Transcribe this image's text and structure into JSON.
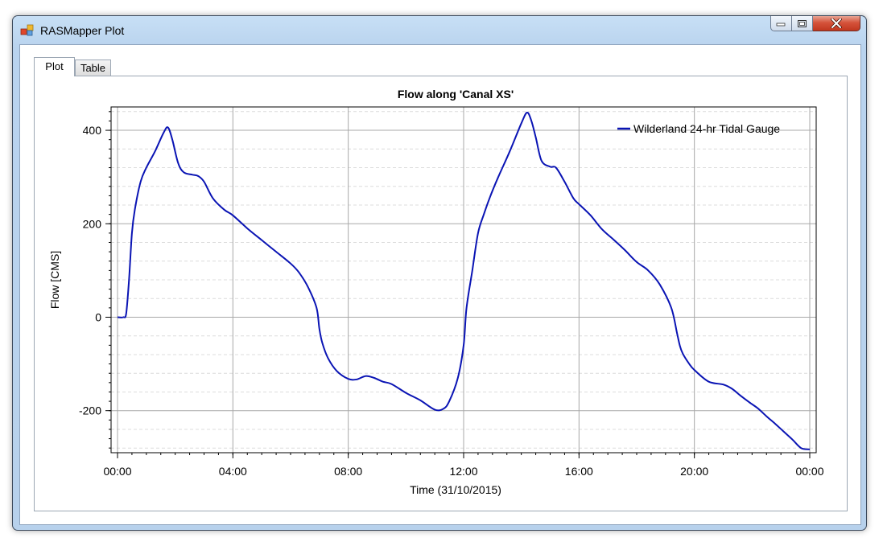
{
  "window": {
    "title": "RASMapper Plot",
    "accent_color": "#b9d3ee"
  },
  "tabs": [
    {
      "label": "Plot",
      "selected": true
    },
    {
      "label": "Table",
      "selected": false
    }
  ],
  "chart_data": {
    "type": "line",
    "title": "Flow along 'Canal XS'",
    "xlabel": "Time (31/10/2015)",
    "ylabel": "Flow [CMS]",
    "x_unit": "hours",
    "xlim": [
      0,
      24
    ],
    "ylim": [
      -290,
      450
    ],
    "x_ticks": [
      {
        "value": 0,
        "label": "00:00"
      },
      {
        "value": 4,
        "label": "04:00"
      },
      {
        "value": 8,
        "label": "08:00"
      },
      {
        "value": 12,
        "label": "12:00"
      },
      {
        "value": 16,
        "label": "16:00"
      },
      {
        "value": 20,
        "label": "20:00"
      },
      {
        "value": 24,
        "label": "00:00"
      }
    ],
    "y_ticks": [
      {
        "value": 400,
        "label": "400"
      },
      {
        "value": 200,
        "label": "200"
      },
      {
        "value": 0,
        "label": "0"
      },
      {
        "value": -200,
        "label": "-200"
      }
    ],
    "grid": true,
    "legend_position": "top-right",
    "series": [
      {
        "name": "Wilderland 24-hr Tidal Gauge",
        "color": "#0a14b4",
        "x": [
          0,
          0.2,
          0.3,
          0.4,
          0.5,
          0.6,
          0.8,
          1.0,
          1.3,
          1.6,
          1.75,
          1.9,
          2.1,
          2.3,
          2.6,
          2.8,
          3.0,
          3.3,
          3.7,
          4.0,
          4.5,
          5.0,
          5.5,
          6.0,
          6.3,
          6.6,
          6.9,
          7.0,
          7.1,
          7.3,
          7.6,
          8.0,
          8.3,
          8.6,
          8.9,
          9.2,
          9.5,
          10.0,
          10.5,
          11.0,
          11.3,
          11.5,
          11.8,
          12.0,
          12.1,
          12.3,
          12.5,
          12.7,
          12.9,
          13.2,
          13.6,
          14.0,
          14.2,
          14.35,
          14.5,
          14.7,
          15.0,
          15.2,
          15.5,
          15.8,
          16.0,
          16.4,
          16.8,
          17.2,
          17.6,
          18.0,
          18.4,
          18.8,
          19.2,
          19.4,
          19.5,
          19.6,
          19.8,
          20.0,
          20.5,
          21.0,
          21.3,
          21.6,
          21.9,
          22.2,
          22.5,
          22.8,
          23.1,
          23.4,
          23.7,
          24.0
        ],
        "y": [
          0,
          0,
          8,
          80,
          180,
          230,
          290,
          320,
          355,
          395,
          406,
          380,
          330,
          310,
          305,
          302,
          290,
          255,
          230,
          218,
          190,
          165,
          140,
          115,
          95,
          65,
          20,
          -25,
          -55,
          -88,
          -115,
          -132,
          -133,
          -126,
          -130,
          -138,
          -143,
          -162,
          -178,
          -198,
          -196,
          -180,
          -130,
          -60,
          20,
          100,
          180,
          220,
          255,
          300,
          355,
          415,
          438,
          420,
          385,
          335,
          322,
          320,
          290,
          255,
          242,
          218,
          188,
          166,
          143,
          118,
          100,
          70,
          20,
          -35,
          -62,
          -78,
          -98,
          -113,
          -138,
          -144,
          -153,
          -168,
          -182,
          -195,
          -212,
          -228,
          -245,
          -262,
          -280,
          -283
        ]
      }
    ]
  }
}
